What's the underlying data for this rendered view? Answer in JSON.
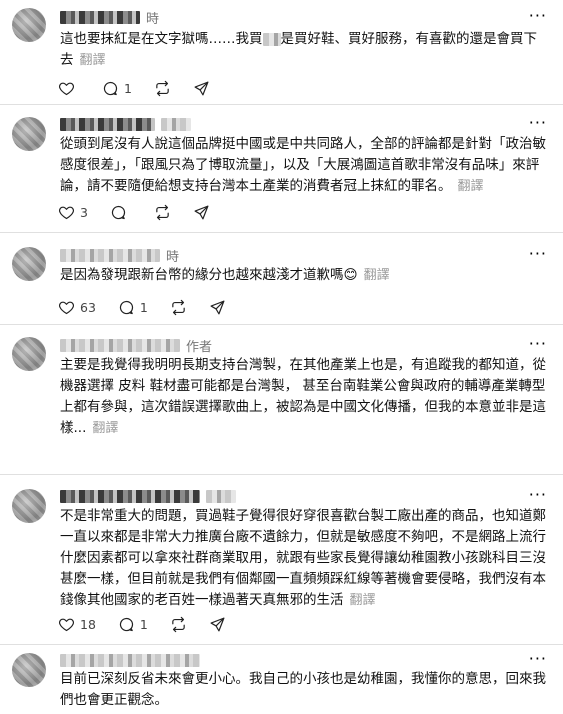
{
  "posts": [
    {
      "time": "時",
      "text": "這也要抹紅是在文字獄嗎……我買",
      "text_b": "是買好鞋、買好服務，有喜歡的還是會買下去",
      "translate": "翻譯",
      "likes": "",
      "replies": "1"
    },
    {
      "text": "從頭到尾沒有人說這個品牌挺中國或是中共同路人，全部的評論都是針對「政治敏感度很差」，「跟風只為了博取流量」，以及「大展鴻圖這首歌非常沒有品味」來評論，請不要隨便給想支持台灣本土產業的消費者冠上抹紅的罪名。",
      "translate": "翻譯",
      "likes": "3",
      "replies": ""
    },
    {
      "time": "時",
      "text": "是因為發現跟新台幣的緣分也越來越淺才道歉嗎",
      "emoji": "😊",
      "translate": "翻譯",
      "likes": "63",
      "replies": "1"
    },
    {
      "author_tag": "作者",
      "text": "主要是我覺得我明明長期支持台灣製，在其他產業上也是，有追蹤我的都知道，從機器選擇 皮料 鞋材盡可能都是台灣製， 甚至台南鞋業公會與政府的輔導產業轉型上都有參與，這次錯誤選擇歌曲上，被認為是中國文化傳播，但我的本意並非是這樣...",
      "translate": "翻譯",
      "likes": "",
      "replies": ""
    },
    {
      "text": "不是非常重大的問題，買過鞋子覺得很好穿很喜歡台製工廠出產的商品，也知道鄭一直以來都是非常大力推廣台廠不遺餘力，但就是敏感度不夠吧，不是網路上流行什麼因素都可以拿來社群商業取用，就跟有些家長覺得讓幼稚園教小孩跳科目三沒甚麼一樣，但目前就是我們有個鄰國一直頻頻踩紅線等著機會要侵略，我們沒有本錢像其他國家的老百姓一樣過著天真無邪的生活",
      "translate": "翻譯",
      "likes": "18",
      "replies": "1"
    },
    {
      "text": "目前已深刻反省未來會更小心。我自己的小孩也是幼稚園，我懂你的意思，回來我們也會更正觀念。"
    }
  ],
  "more_label": "···"
}
